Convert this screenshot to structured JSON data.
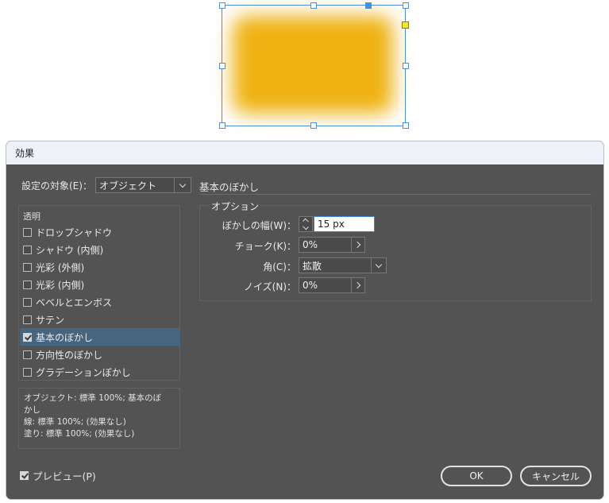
{
  "dialog": {
    "title": "効果",
    "target_label": "設定の対象(E)：",
    "target_value": "オブジェクト",
    "section_heading": "基本のぼかし"
  },
  "effects_list": {
    "header": "透明",
    "items": [
      {
        "label": "ドロップシャドウ",
        "checked": false,
        "selected": false
      },
      {
        "label": "シャドウ (内側)",
        "checked": false,
        "selected": false
      },
      {
        "label": "光彩 (外側)",
        "checked": false,
        "selected": false
      },
      {
        "label": "光彩 (内側)",
        "checked": false,
        "selected": false
      },
      {
        "label": "ベベルとエンボス",
        "checked": false,
        "selected": false
      },
      {
        "label": "サテン",
        "checked": false,
        "selected": false
      },
      {
        "label": "基本のぼかし",
        "checked": true,
        "selected": true
      },
      {
        "label": "方向性のぼかし",
        "checked": false,
        "selected": false
      },
      {
        "label": "グラデーションぼかし",
        "checked": false,
        "selected": false
      }
    ]
  },
  "summary": {
    "line1": "オブジェクト: 標準 100%; 基本のぼ",
    "line2": "かし",
    "line3": "線: 標準 100%; (効果なし)",
    "line4": "塗り: 標準 100%; (効果なし)"
  },
  "options": {
    "legend": "オプション",
    "width_label": "ぼかしの幅(W)：",
    "width_value": "15 px",
    "choke_label": "チョーク(K)：",
    "choke_value": "0%",
    "corner_label": "角(C)：",
    "corner_value": "拡散",
    "noise_label": "ノイズ(N)：",
    "noise_value": "0%"
  },
  "footer": {
    "preview_label": "プレビュー(P)",
    "preview_checked": true,
    "ok_label": "OK",
    "cancel_label": "キャンセル"
  },
  "colors": {
    "object_fill": "#efb212",
    "selection": "#4c8fe0",
    "dialog_bg": "#535353",
    "selected_row": "#46657f"
  }
}
